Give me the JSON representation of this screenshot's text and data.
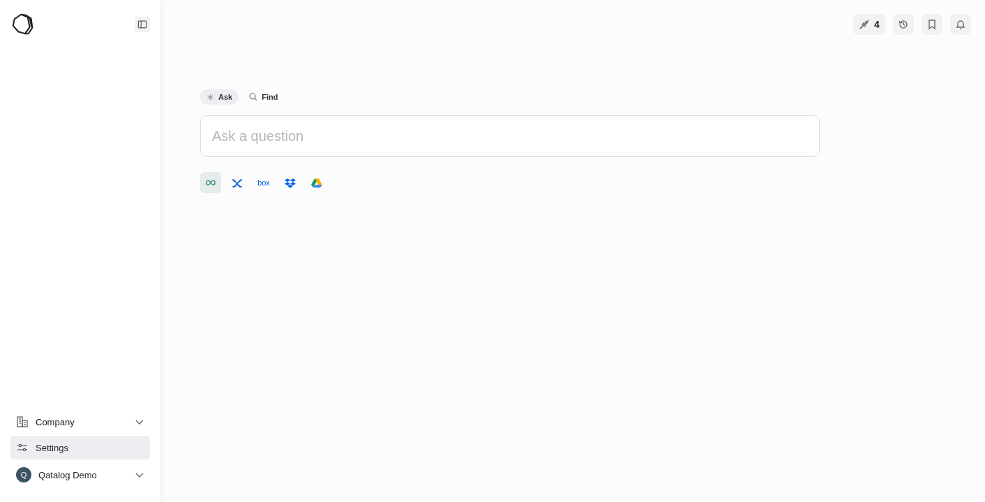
{
  "modes": [
    {
      "label": "Ask",
      "kind": "ask",
      "selected": true
    },
    {
      "label": "Find",
      "kind": "find",
      "selected": false
    }
  ],
  "search": {
    "placeholder": "Ask a question"
  },
  "sources": [
    {
      "kind": "all",
      "selected": true
    },
    {
      "kind": "confluence",
      "selected": false
    },
    {
      "kind": "box",
      "label": "box",
      "selected": false
    },
    {
      "kind": "dropbox",
      "selected": false
    },
    {
      "kind": "drive",
      "selected": false
    }
  ],
  "toolbar": {
    "integrations_count": "4"
  },
  "sidebar": {
    "items": [
      {
        "label": "Company",
        "kind": "company",
        "expandable": true,
        "selected": false
      },
      {
        "label": "Settings",
        "kind": "settings",
        "expandable": false,
        "selected": true
      }
    ],
    "user": {
      "initial": "Q",
      "name": "Qatalog Demo"
    }
  }
}
